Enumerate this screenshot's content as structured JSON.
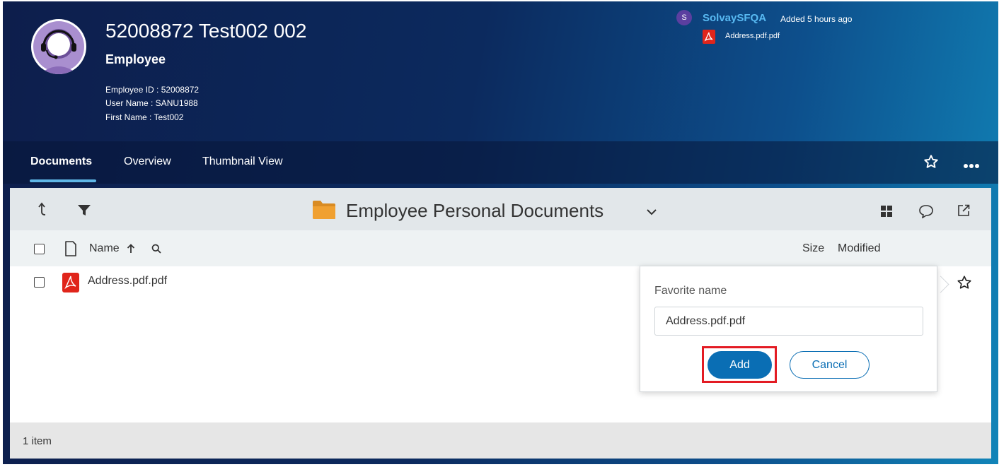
{
  "header": {
    "title": "52008872 Test002 002",
    "subtitle": "Employee",
    "employee_id": "Employee ID : 52008872",
    "user_name": "User Name : SANU1988",
    "first_name": "First Name : Test002",
    "avatar_icon": "headset-user-icon"
  },
  "activity": {
    "badge": "S",
    "user": "SolvaySFQA",
    "time": "Added 5 hours ago",
    "file": "Address.pdf.pdf",
    "file_icon": "pdf-icon"
  },
  "tabs": [
    {
      "label": "Documents",
      "active": true
    },
    {
      "label": "Overview",
      "active": false
    },
    {
      "label": "Thumbnail View",
      "active": false
    }
  ],
  "tab_actions": {
    "favorite_icon": "star-outline-icon",
    "more_icon": "more-horizontal-icon"
  },
  "toolbar": {
    "folder_title": "Employee Personal Documents",
    "icons": [
      "up-level-icon",
      "filter-icon",
      "folder-icon",
      "chevron-down-icon",
      "grid-view-icon",
      "comment-icon",
      "open-external-icon"
    ]
  },
  "columns": {
    "name": "Name",
    "size": "Size",
    "modified": "Modified"
  },
  "rows": [
    {
      "name": "Address.pdf.pdf",
      "type": "pdf-icon"
    }
  ],
  "footer": {
    "count": "1 item"
  },
  "favorite_popover": {
    "label": "Favorite name",
    "value": "Address.pdf.pdf",
    "add_label": "Add",
    "cancel_label": "Cancel"
  },
  "colors": {
    "header_dark": "#0d1e4c",
    "header_light": "#1184b8",
    "accent": "#0a6eb4",
    "highlight": "#e31b23",
    "pdf_red": "#e0251b",
    "folder_orange": "#f0a030"
  }
}
